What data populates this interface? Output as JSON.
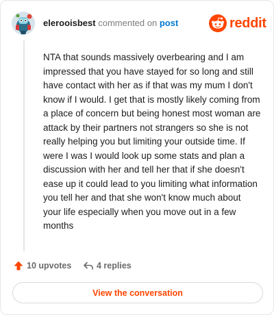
{
  "header": {
    "username": "elerooisbest",
    "verb": "commented on",
    "post_link": "post",
    "logo_text": "reddit"
  },
  "comment": {
    "body": "NTA that sounds massively overbearing and I am impressed that you have stayed for so long and still have contact with her as if that was my mum I don't know if I would. I get that is mostly likely coming from a place of concern but being honest most woman are attack by their partners not strangers so she is not really helping you but limiting your outside time. If were I was I would look up some stats and plan a discussion with her and tell her that if she doesn't ease up it could lead to you limiting what information you tell her and that she won't know much about your life especially when you move out in a few months"
  },
  "actions": {
    "upvotes_label": "10 upvotes",
    "replies_label": "4 replies"
  },
  "cta": {
    "label": "View the conversation"
  },
  "colors": {
    "accent": "#ff4500",
    "link": "#0079d3",
    "muted": "#7c7c7c"
  },
  "icons": {
    "upvote": "upvote-arrow-icon",
    "reply": "reply-arrow-icon",
    "logo": "reddit-snoo-icon"
  }
}
